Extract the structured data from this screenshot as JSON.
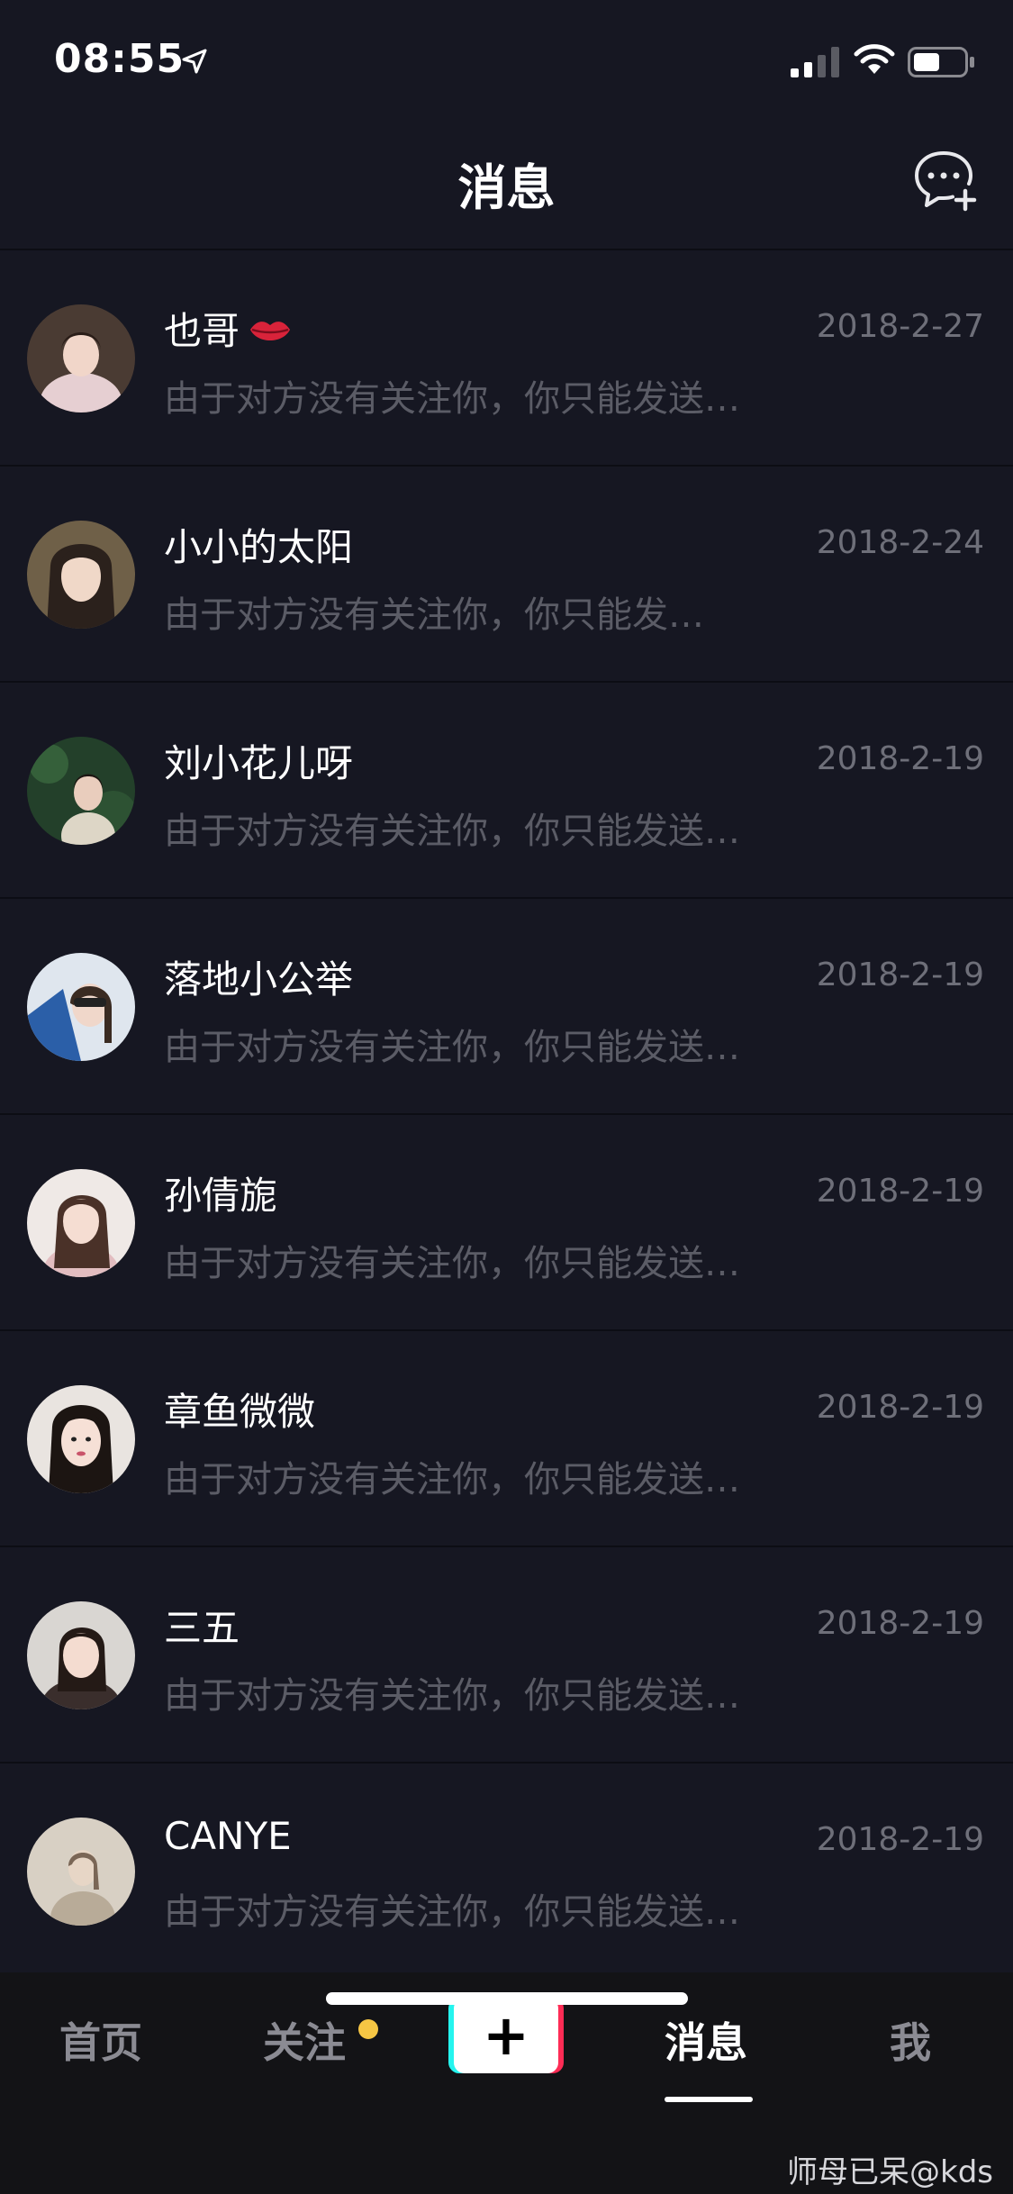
{
  "status_bar": {
    "time": "08:55",
    "icons": [
      "location-arrow-icon",
      "signal-icon",
      "wifi-icon",
      "battery-icon"
    ]
  },
  "nav": {
    "title": "消息",
    "action_icon": "new-chat-icon"
  },
  "messages": [
    {
      "name": "也哥",
      "emoji": "lips-icon",
      "date": "2018-2-27",
      "preview": "由于对方没有关注你，你只能发送…"
    },
    {
      "name": "小小的太阳",
      "date": "2018-2-24",
      "preview": "由于对方没有关注你，你只能发…"
    },
    {
      "name": "刘小花儿呀",
      "date": "2018-2-19",
      "preview": "由于对方没有关注你，你只能发送…"
    },
    {
      "name": "落地小公举",
      "date": "2018-2-19",
      "preview": "由于对方没有关注你，你只能发送…"
    },
    {
      "name": "孙倩旎",
      "date": "2018-2-19",
      "preview": "由于对方没有关注你，你只能发送…"
    },
    {
      "name": "章鱼微微",
      "date": "2018-2-19",
      "preview": "由于对方没有关注你，你只能发送…"
    },
    {
      "name": "三五",
      "date": "2018-2-19",
      "preview": "由于对方没有关注你，你只能发送…"
    },
    {
      "name": "CANYE",
      "date": "2018-2-19",
      "preview": "由于对方没有关注你，你只能发送…"
    }
  ],
  "tabs": {
    "home": "首页",
    "follow": "关注",
    "create": "+",
    "messages": "消息",
    "me": "我",
    "active": "messages"
  },
  "colors": {
    "background": "#161722",
    "date_text": "#6e6f79",
    "preview_text": "#5b5c66",
    "notification_dot": "#f6c644",
    "brand_cyan": "#25f4ee",
    "brand_red": "#fe2c55"
  },
  "watermark": "师母已呆@kds"
}
